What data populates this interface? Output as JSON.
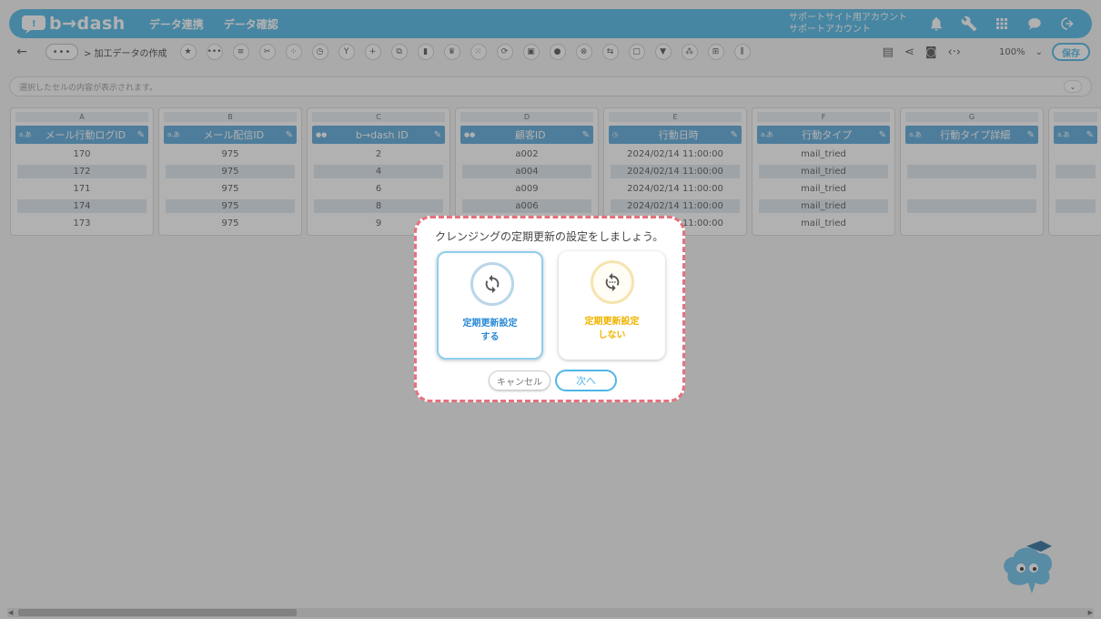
{
  "header": {
    "brand": "b→dash",
    "nav": [
      "データ連携",
      "データ確認"
    ],
    "account_line1": "サポートサイト用アカウント",
    "account_line2": "サポートアカウント",
    "icons": [
      "bell-icon",
      "wrench-icon",
      "apps-grid-icon",
      "chat-icon",
      "logout-icon"
    ],
    "accent_color": "#4fb7e6"
  },
  "toolbar": {
    "back": "←",
    "more": "•••",
    "breadcrumb": "> 加工データの作成",
    "tools": [
      "star-icon",
      "dots-icon",
      "note-icon",
      "cut-icon",
      "grid-dots-icon",
      "timer-icon",
      "merge-icon",
      "plus-icon",
      "copy-icon",
      "trash-icon",
      "crown-icon",
      "scatter-icon",
      "refresh-icon",
      "lock-icon",
      "bag-icon",
      "x-circle-icon",
      "sync-icon",
      "frame-icon",
      "filter-icon",
      "group-icon",
      "table-icon",
      "split-icon"
    ],
    "right_icons": [
      "clipboard-icon",
      "share-icon",
      "refresh-doc-icon",
      "code-icon"
    ],
    "zoom": "100%",
    "save": "保存"
  },
  "formula_bar": {
    "placeholder": "選択したセルの内容が表示されます。"
  },
  "columns": [
    {
      "letter": "A",
      "name": "メール行動ログID",
      "type": "テキスト",
      "cells": [
        "170",
        "172",
        "171",
        "174",
        "173"
      ]
    },
    {
      "letter": "B",
      "name": "メール配信ID",
      "type": "テキスト",
      "cells": [
        "975",
        "975",
        "975",
        "975",
        "975"
      ]
    },
    {
      "letter": "C",
      "name": "b→dash ID",
      "type": "ID",
      "cells": [
        "2",
        "4",
        "6",
        "8",
        "9"
      ]
    },
    {
      "letter": "D",
      "name": "顧客ID",
      "type": "ID",
      "cells": [
        "a002",
        "a004",
        "a009",
        "a006",
        ""
      ]
    },
    {
      "letter": "E",
      "name": "行動日時",
      "type": "日時",
      "cells": [
        "2024/02/14 11:00:00",
        "2024/02/14 11:00:00",
        "2024/02/14 11:00:00",
        "2024/02/14 11:00:00",
        "2024/02/14 11:00:00"
      ]
    },
    {
      "letter": "F",
      "name": "行動タイプ",
      "type": "テキスト",
      "cells": [
        "mail_tried",
        "mail_tried",
        "mail_tried",
        "mail_tried",
        "mail_tried"
      ]
    },
    {
      "letter": "G",
      "name": "行動タイプ詳細",
      "type": "テキスト",
      "cells": [
        "",
        "",
        "",
        "",
        ""
      ]
    },
    {
      "letter": "",
      "name": "",
      "type": "テキスト",
      "cells": [
        "",
        "",
        "",
        "",
        ""
      ]
    }
  ],
  "dialog": {
    "title": "クレンジングの定期更新の設定をしましょう。",
    "option_on_line1": "定期更新設定",
    "option_on_line2": "する",
    "option_off_line1": "定期更新設定",
    "option_off_line2": "しない",
    "cancel": "キャンセル",
    "next": "次へ",
    "highlight_color": "#e5717e"
  }
}
